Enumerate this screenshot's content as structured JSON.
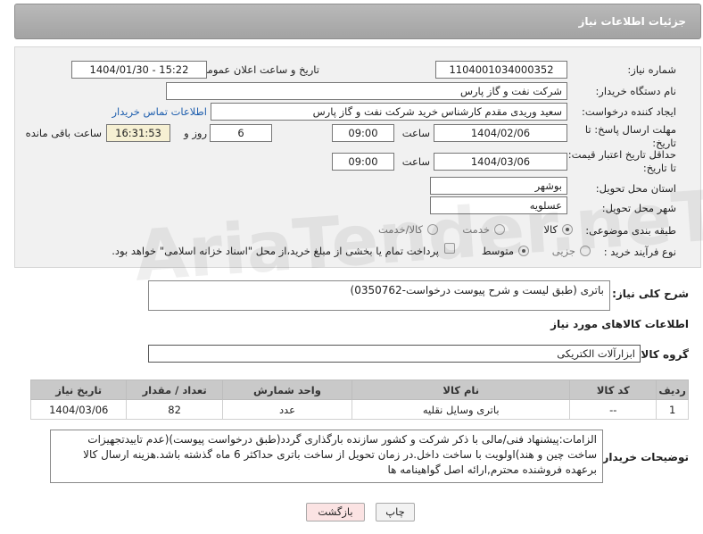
{
  "header": {
    "title": "جزئیات اطلاعات نیاز"
  },
  "form": {
    "need_number_label": "شماره نیاز:",
    "need_number": "1104001034000352",
    "announce_label": "تاریخ و ساعت اعلان عمومی:",
    "announce_value": "1404/01/30 - 15:22",
    "buyer_org_label": "نام دستگاه خریدار:",
    "buyer_org": "شرکت نفت و گاز پارس",
    "creator_label": "ایجاد کننده درخواست:",
    "creator": "سعید وریدی مقدم کارشناس خرید شرکت نفت و گاز پارس",
    "contact_link": "اطلاعات تماس خریدار",
    "reply_deadline_label": "مهلت ارسال پاسخ: تا تاریخ:",
    "reply_date": "1404/02/06",
    "time_label": "ساعت",
    "reply_time": "09:00",
    "days_value": "6",
    "days_label": "روز و",
    "remaining_time": "16:31:53",
    "remaining_label": "ساعت باقی مانده",
    "validity_label": "حداقل تاریخ اعتبار قیمت: تا تاریخ:",
    "validity_date": "1404/03/06",
    "validity_time": "09:00",
    "province_label": "استان محل تحویل:",
    "province": "بوشهر",
    "city_label": "شهر محل تحویل:",
    "city": "عسلویه",
    "category_label": "طبقه بندی موضوعی:",
    "category_options": [
      "کالا",
      "خدمت",
      "کالا/خدمت"
    ],
    "process_label": "نوع فرآیند خرید :",
    "process_options": [
      "جزیی",
      "متوسط"
    ],
    "payment_note": "پرداخت تمام یا بخشی از مبلغ خرید،از محل \"اسناد خزانه اسلامی\" خواهد بود."
  },
  "description": {
    "label": "شرح کلی نیاز:",
    "text": "باتری (طبق لیست و شرح پیوست درخواست-0350762)"
  },
  "goods": {
    "section_title": "اطلاعات کالاهای مورد نیاز",
    "group_label": "گروه کالا:",
    "group_value": "ابزارآلات الکتریکی",
    "columns": [
      "ردیف",
      "کد کالا",
      "نام کالا",
      "واحد شمارش",
      "تعداد / مقدار",
      "تاریخ نیاز"
    ],
    "rows": [
      [
        "1",
        "--",
        "باتری وسایل نقلیه",
        "عدد",
        "82",
        "1404/03/06"
      ]
    ]
  },
  "notes": {
    "label": "توضیحات خریدار:",
    "text": "الزامات:پیشنهاد فنی/مالی با ذکر شرکت و کشور سازنده بارگذاری گردد(طبق درخواست پیوست)(عدم تاییدتجهیزات ساخت چین و هند)اولویت با ساخت داخل.در زمان تحویل از ساخت باتری حداکثر 6 ماه گذشته باشد.هزینه ارسال کالا برعهده فروشنده محترم,ارائه اصل گواهینامه ها"
  },
  "buttons": {
    "print": "چاپ",
    "back": "بازگشت"
  },
  "watermark": "AriaTender.neT"
}
